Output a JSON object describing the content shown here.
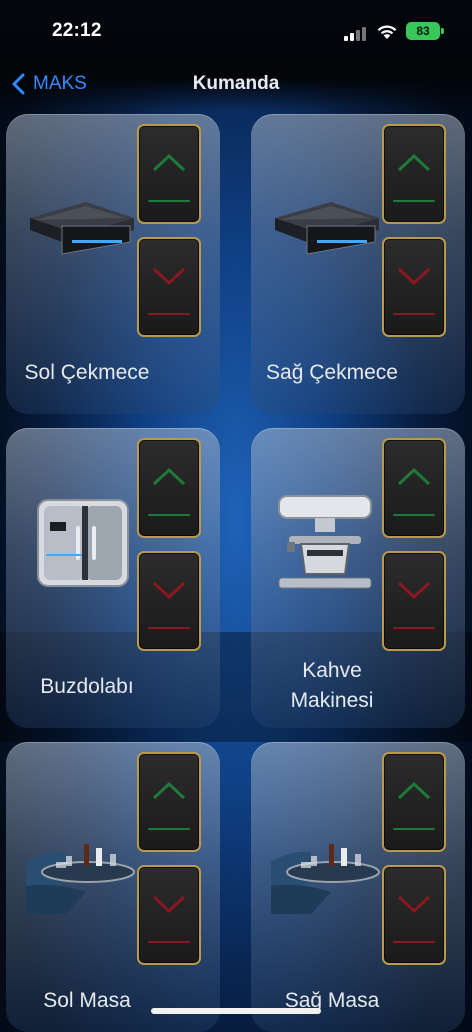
{
  "status_bar": {
    "time": "22:12",
    "battery": "83"
  },
  "nav": {
    "back_label": "MAKS",
    "title": "Kumanda"
  },
  "colors": {
    "accent": "#2f8cff",
    "up_arrow": "#1f7a3a",
    "down_arrow": "#8a1822",
    "button_border": "#b99a4c"
  },
  "cards": [
    {
      "label": "Sol Çekmece",
      "icon": "drawer-icon"
    },
    {
      "label": "Sağ Çekmece",
      "icon": "drawer-icon"
    },
    {
      "label": "Buzdolabı",
      "icon": "fridge-icon"
    },
    {
      "label_line1": "Kahve",
      "label_line2": "Makinesi",
      "icon": "coffee-machine-icon"
    },
    {
      "label": "Sol Masa",
      "icon": "table-icon"
    },
    {
      "label": "Sağ Masa",
      "icon": "table-icon"
    }
  ]
}
